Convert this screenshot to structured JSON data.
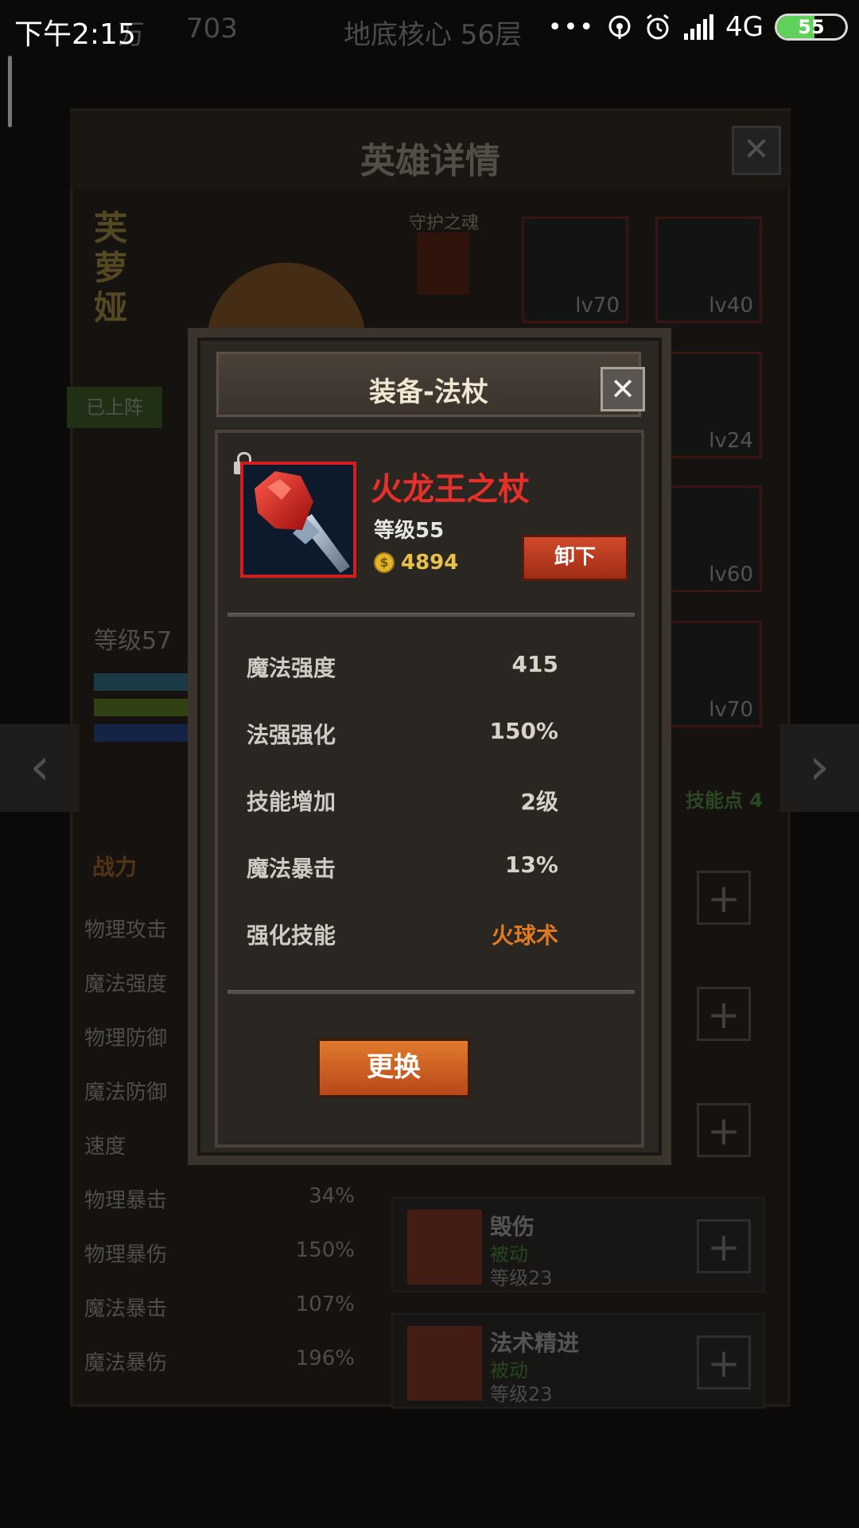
{
  "status_bar": {
    "time": "下午2:15",
    "dots": "•••",
    "network": "4G",
    "battery_level": "55",
    "battery_fraction": 0.55
  },
  "background": {
    "resource_1": "万",
    "resource_2": "703",
    "dungeon": "地底核心 56层",
    "panel_title": "英雄详情",
    "close_symbol": "✕",
    "hero_name": "芙萝娅",
    "guard_label": "守护之魂",
    "deployed_label": "已上阵",
    "hero_level": "等级57",
    "equipment_levels": [
      "lv70",
      "lv40",
      "lv24",
      "lv60",
      "lv70"
    ],
    "nav_left": "‹",
    "nav_right": "›",
    "skill_points": "技能点 4",
    "fighting_label": "战力",
    "stats": [
      {
        "label": "物理攻击",
        "value": ""
      },
      {
        "label": "魔法强度",
        "value": ""
      },
      {
        "label": "物理防御",
        "value": ""
      },
      {
        "label": "魔法防御",
        "value": ""
      },
      {
        "label": "速度",
        "value": ""
      },
      {
        "label": "物理暴击",
        "value": "34%"
      },
      {
        "label": "物理暴伤",
        "value": "150%"
      },
      {
        "label": "魔法暴击",
        "value": "107%"
      },
      {
        "label": "魔法暴伤",
        "value": "196%"
      }
    ],
    "skills": [
      {
        "name": "毁伤",
        "type": "被动",
        "level": "等级23"
      },
      {
        "name": "法术精进",
        "type": "被动",
        "level": "等级23"
      }
    ],
    "plus_symbol": "+"
  },
  "dialog": {
    "title": "装备-法杖",
    "close_symbol": "✕",
    "item_name": "火龙王之杖",
    "item_level": "等级55",
    "coin_symbol": "$",
    "price": "4894",
    "unequip_label": "卸下",
    "attributes": [
      {
        "label": "魔法强度",
        "value": "415"
      },
      {
        "label": "法强强化",
        "value": "150%"
      },
      {
        "label": "技能增加",
        "value": "2级"
      },
      {
        "label": "魔法暴击",
        "value": "13%"
      },
      {
        "label": "强化技能",
        "value": "火球术"
      }
    ],
    "replace_label": "更换"
  }
}
